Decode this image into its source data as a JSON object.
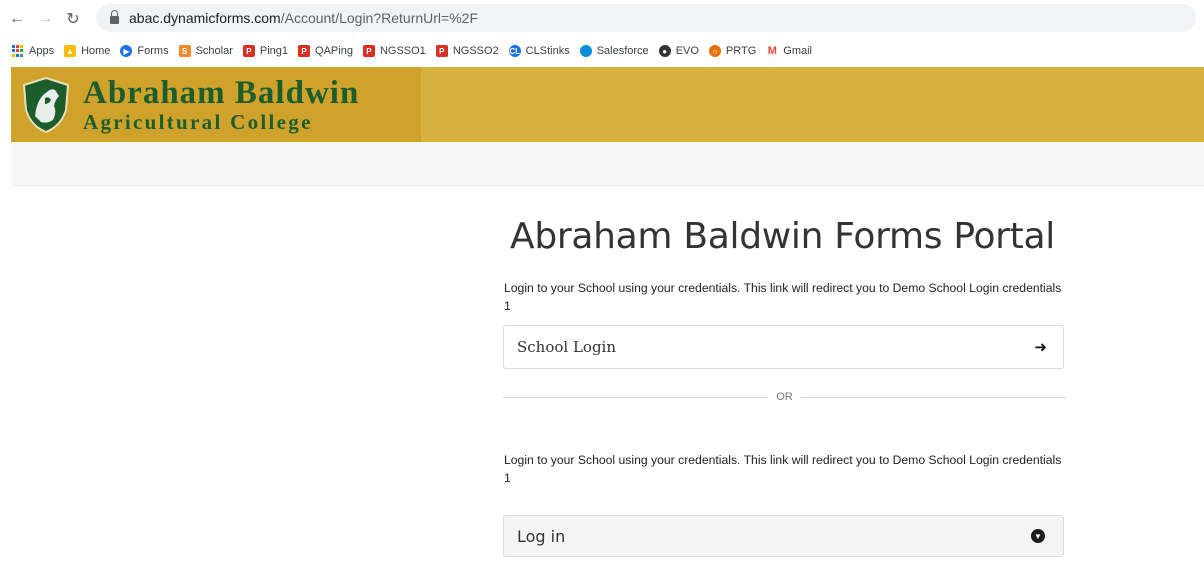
{
  "browser": {
    "url_host": "abac.dynamicforms.com",
    "url_path": "/Account/Login?ReturnUrl=%2F"
  },
  "bookmarks": [
    {
      "label": "Apps",
      "icon": "apps-grid-icon",
      "color": "#1a73e8"
    },
    {
      "label": "Home",
      "icon": "home-icon",
      "color": "#fbbc04"
    },
    {
      "label": "Forms",
      "icon": "forms-icon",
      "color": "#1a73e8"
    },
    {
      "label": "Scholar",
      "icon": "scholar-icon",
      "color": "#f28b2c"
    },
    {
      "label": "Ping1",
      "icon": "ping-icon",
      "color": "#d93025"
    },
    {
      "label": "QAPing",
      "icon": "ping-icon",
      "color": "#d93025"
    },
    {
      "label": "NGSSO1",
      "icon": "ping-icon",
      "color": "#d93025"
    },
    {
      "label": "NGSSO2",
      "icon": "ping-icon",
      "color": "#d93025"
    },
    {
      "label": "CLStinks",
      "icon": "cl-icon",
      "color": "#1a73e8"
    },
    {
      "label": "Salesforce",
      "icon": "salesforce-icon",
      "color": "#0b8fd8"
    },
    {
      "label": "EVO",
      "icon": "evo-icon",
      "color": "#333333"
    },
    {
      "label": "PRTG",
      "icon": "prtg-icon",
      "color": "#e8710a"
    },
    {
      "label": "Gmail",
      "icon": "gmail-icon",
      "color": "#ea4335"
    }
  ],
  "header": {
    "logo_line1": "Abraham Baldwin",
    "logo_line2": "Agricultural College",
    "gold_color": "#d8b23e",
    "logo_green": "#1d5d2c"
  },
  "main": {
    "title": "Abraham Baldwin Forms Portal",
    "description_1": "Login to your School using your credentials. This link will redirect you to Demo School Login credentials 1",
    "school_login_label": "School Login",
    "or_label": "OR",
    "description_2": "Login to your School using your credentials. This link will redirect you to Demo School Login credentials 1",
    "login_label": "Log in"
  }
}
